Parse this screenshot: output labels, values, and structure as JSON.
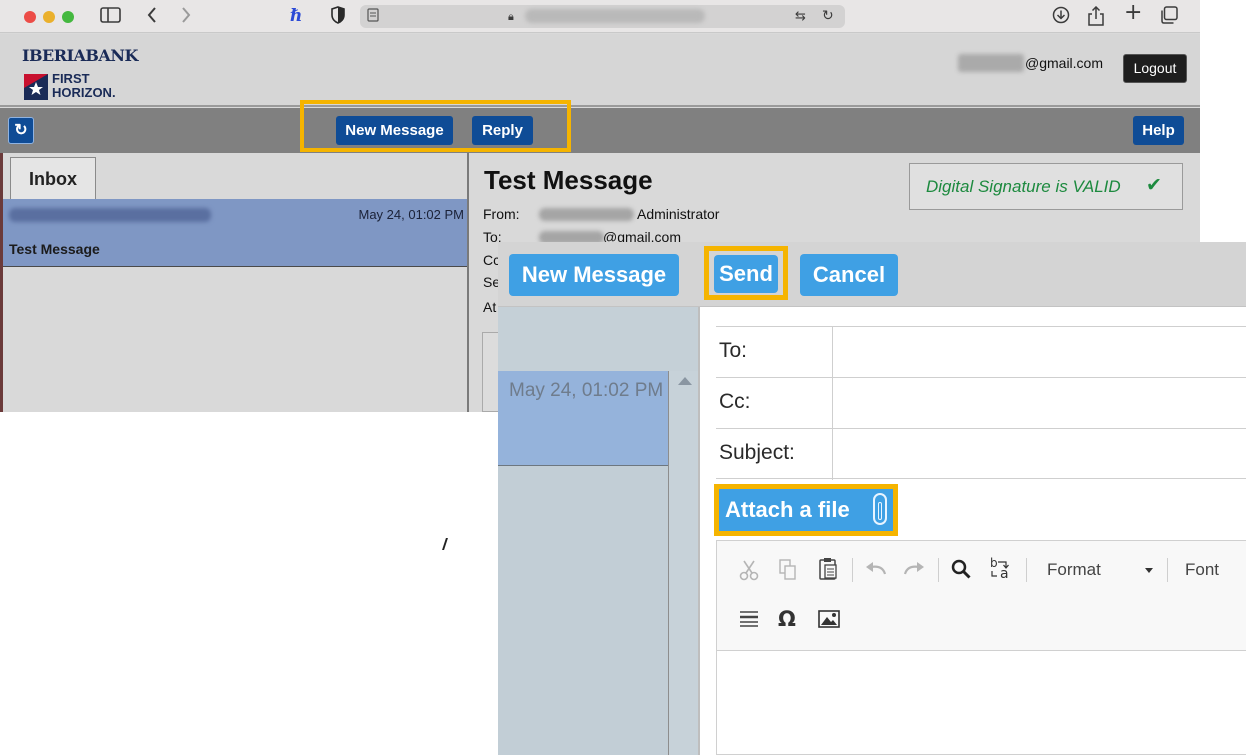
{
  "browser": {
    "url_blurred": true,
    "icons": [
      "sidebar-icon",
      "back-icon",
      "forward-icon",
      "honey-extension-icon",
      "shield-icon",
      "reader-icon",
      "translate-icon",
      "reload-icon",
      "download-icon",
      "share-icon",
      "new-tab-icon",
      "tabs-icon"
    ]
  },
  "header": {
    "logo_top": "IBERIABANK",
    "logo_first": "FIRST",
    "logo_horizon": "HORIZON.",
    "email_suffix": "@gmail.com",
    "logout_label": "Logout"
  },
  "toolbar": {
    "refresh_glyph": "↻",
    "new_message_label": "New Message",
    "reply_label": "Reply",
    "help_label": "Help"
  },
  "inbox": {
    "tab_label": "Inbox",
    "rows": [
      {
        "date": "May 24, 01:02 PM",
        "subject": "Test Message"
      }
    ]
  },
  "message": {
    "title": "Test Message",
    "signature_text": "Digital Signature is VALID",
    "signature_check": "✔",
    "from_label": "From:",
    "from_role": "Administrator",
    "to_label": "To:",
    "to_suffix": "@gmail.com",
    "cc_label_partial": "Cc",
    "se_label_partial": "Se",
    "at_label_partial": "At"
  },
  "compose": {
    "new_message_label": "New Message",
    "send_label": "Send",
    "cancel_label": "Cancel",
    "list_date": "May 24, 01:02 PM",
    "to_label": "To:",
    "cc_label": "Cc:",
    "subject_label": "Subject:",
    "to_value": "",
    "cc_value": "",
    "subject_value": "",
    "attach_label": "Attach a file",
    "format_label": "Format",
    "font_label": "Font"
  },
  "colors": {
    "highlight": "#f5b400",
    "bank_button": "#0f4c96",
    "compose_button": "#3fa0e4",
    "selected_row": "#7f97c4",
    "signature_green": "#1d8a3f"
  }
}
